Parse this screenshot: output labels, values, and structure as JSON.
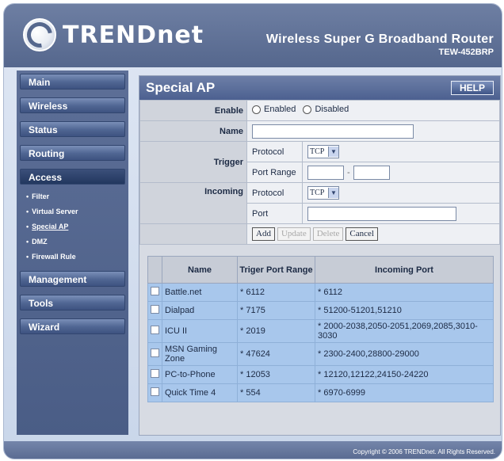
{
  "header": {
    "logo_text": "TRENDnet",
    "product_line1": "Wireless Super G Broadband Router",
    "product_line2": "TEW-452BRP"
  },
  "sidebar": {
    "items": [
      {
        "label": "Main"
      },
      {
        "label": "Wireless"
      },
      {
        "label": "Status"
      },
      {
        "label": "Routing"
      },
      {
        "label": "Access"
      },
      {
        "label": "Management"
      },
      {
        "label": "Tools"
      },
      {
        "label": "Wizard"
      }
    ],
    "access_subitems": [
      {
        "label": "Filter"
      },
      {
        "label": "Virtual Server"
      },
      {
        "label": "Special AP"
      },
      {
        "label": "DMZ"
      },
      {
        "label": "Firewall Rule"
      }
    ]
  },
  "panel": {
    "title": "Special AP",
    "help_label": "HELP"
  },
  "form": {
    "enable_label": "Enable",
    "enabled_option": "Enabled",
    "disabled_option": "Disabled",
    "name_label": "Name",
    "name_value": "",
    "trigger_label": "Trigger",
    "trigger_protocol_label": "Protocol",
    "trigger_protocol_value": "TCP",
    "trigger_port_range_label": "Port Range",
    "incoming_label": "Incoming",
    "incoming_protocol_label": "Protocol",
    "incoming_protocol_value": "TCP",
    "incoming_port_label": "Port",
    "range_separator": "-",
    "add_label": "Add",
    "update_label": "Update",
    "delete_label": "Delete",
    "cancel_label": "Cancel"
  },
  "table": {
    "headers": [
      "Name",
      "Triger Port Range",
      "Incoming Port"
    ],
    "rows": [
      {
        "name": "Battle.net",
        "trigger": "* 6112",
        "incoming": "* 6112"
      },
      {
        "name": "Dialpad",
        "trigger": "* 7175",
        "incoming": "* 51200-51201,51210"
      },
      {
        "name": "ICU II",
        "trigger": "* 2019",
        "incoming": "* 2000-2038,2050-2051,2069,2085,3010-3030"
      },
      {
        "name": "MSN Gaming Zone",
        "trigger": "* 47624",
        "incoming": "* 2300-2400,28800-29000"
      },
      {
        "name": "PC-to-Phone",
        "trigger": "* 12053",
        "incoming": "* 12120,12122,24150-24220"
      },
      {
        "name": "Quick Time 4",
        "trigger": "* 554",
        "incoming": "* 6970-6999"
      }
    ]
  },
  "footer": {
    "copyright": "Copyright © 2006 TRENDnet. All Rights Reserved."
  },
  "colors": {
    "header_blue": "#5d6f97",
    "row_blue": "#a8c7ec",
    "panel_gray": "#d7dbe3"
  }
}
